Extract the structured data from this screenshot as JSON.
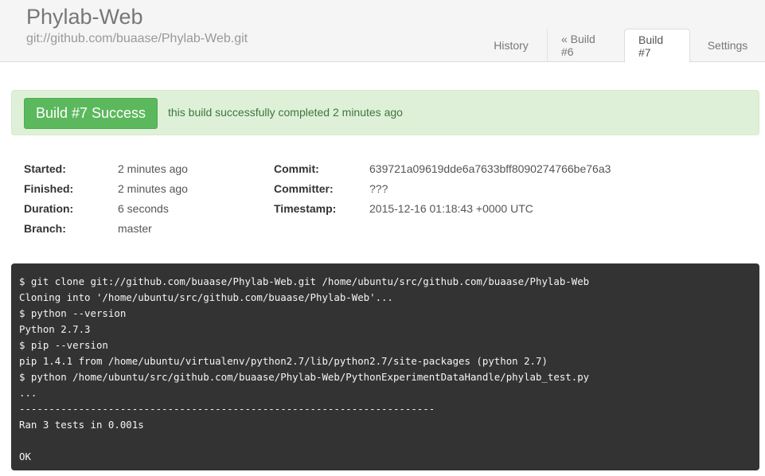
{
  "header": {
    "title": "Phylab-Web",
    "repo_url": "git://github.com/buaase/Phylab-Web.git",
    "tabs": [
      {
        "label": "History"
      },
      {
        "label": "« Build #6"
      },
      {
        "label": "Build #7",
        "active": true
      },
      {
        "label": "Settings"
      }
    ]
  },
  "status": {
    "label": "Build #7 Success",
    "message": "this build successfully completed 2 minutes ago",
    "color": "#5cb85c"
  },
  "details": {
    "left": [
      {
        "label": "Started:",
        "value": "2 minutes ago"
      },
      {
        "label": "Finished:",
        "value": "2 minutes ago"
      },
      {
        "label": "Duration:",
        "value": "6 seconds"
      },
      {
        "label": "Branch:",
        "value": "master"
      }
    ],
    "right": [
      {
        "label": "Commit:",
        "value": "639721a09619dde6a7633bff8090274766be76a3"
      },
      {
        "label": "Committer:",
        "value": "???"
      },
      {
        "label": "Timestamp:",
        "value": "2015-12-16 01:18:43 +0000 UTC"
      }
    ]
  },
  "console": {
    "lines": [
      "$ git clone git://github.com/buaase/Phylab-Web.git /home/ubuntu/src/github.com/buaase/Phylab-Web",
      "Cloning into '/home/ubuntu/src/github.com/buaase/Phylab-Web'...",
      "$ python --version",
      "Python 2.7.3",
      "$ pip --version",
      "pip 1.4.1 from /home/ubuntu/virtualenv/python2.7/lib/python2.7/site-packages (python 2.7)",
      "$ python /home/ubuntu/src/github.com/buaase/Phylab-Web/PythonExperimentDataHandle/phylab_test.py",
      "...",
      "----------------------------------------------------------------------",
      "Ran 3 tests in 0.001s",
      "",
      "OK"
    ]
  }
}
